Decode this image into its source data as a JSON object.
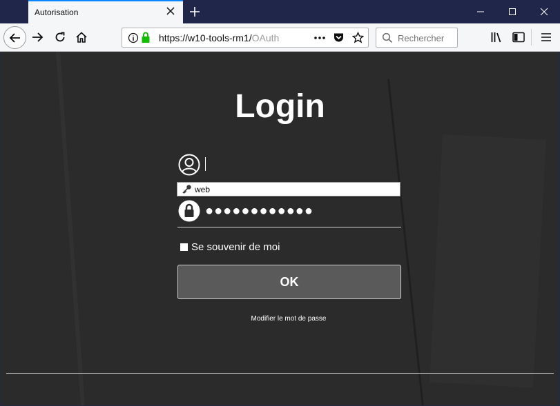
{
  "browser": {
    "tab_title": "Autorisation",
    "url": "https://w10-tools-rm1/OAuth",
    "url_visible_host": "https://w10-tools-rm1/",
    "url_faded": "OAuth",
    "search_placeholder": "Rechercher",
    "accent_color": "#0a84ff",
    "secure_color": "#12bc00",
    "icons": [
      "close-icon",
      "plus-icon",
      "minimize-icon",
      "maximize-icon",
      "window-close-icon",
      "back-icon",
      "forward-icon",
      "reload-icon",
      "home-icon",
      "info-icon",
      "lock-icon",
      "more-icon",
      "pocket-icon",
      "star-icon",
      "search-icon",
      "library-icon",
      "sidebar-icon",
      "menu-icon"
    ]
  },
  "login": {
    "title": "Login",
    "username_value": "",
    "autocomplete_suggestion": "web",
    "password_dots": "●●●●●●●●●●●●",
    "remember_label": "Se souvenir de moi",
    "remember_checked": false,
    "ok_label": "OK",
    "forgot_link": "Modifier le mot de passe"
  }
}
